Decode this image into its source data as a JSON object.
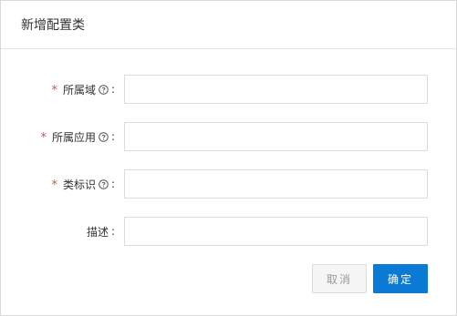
{
  "dialog": {
    "title": "新增配置类"
  },
  "form": {
    "fields": [
      {
        "label": "所属域",
        "required": "*",
        "help_icon": "question-circle-icon",
        "colon": ":",
        "value": "",
        "placeholder": ""
      },
      {
        "label": "所属应用",
        "required": "*",
        "help_icon": "question-circle-icon",
        "colon": ":",
        "value": "",
        "placeholder": ""
      },
      {
        "label": "类标识",
        "required": "*",
        "help_icon": "question-circle-icon",
        "colon": ":",
        "value": "",
        "placeholder": ""
      },
      {
        "label": "描述",
        "colon": ":",
        "value": "",
        "placeholder": ""
      }
    ]
  },
  "footer": {
    "cancel_label": "取消",
    "ok_label": "确定"
  },
  "colors": {
    "primary": "#0a7ad4",
    "required": "#e84c3d",
    "border": "#dcdcdc"
  }
}
